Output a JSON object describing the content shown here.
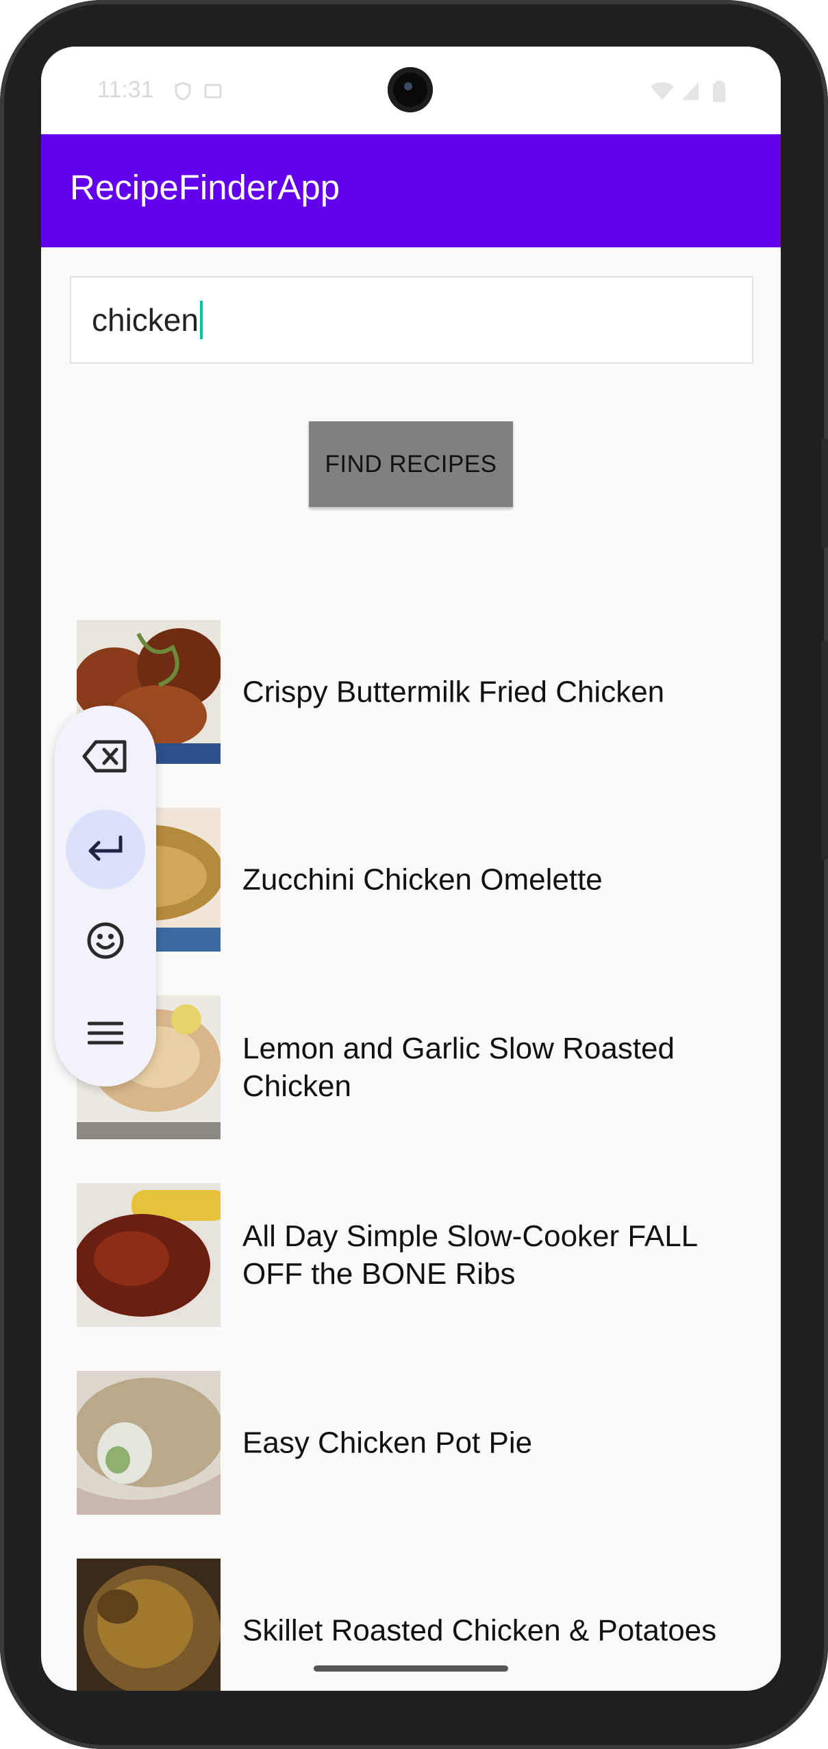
{
  "status_bar": {
    "time": "11:31"
  },
  "app_bar": {
    "title": "RecipeFinderApp",
    "color": "#6200ee"
  },
  "search": {
    "value": "chicken"
  },
  "find_button": {
    "label": "FIND RECIPES"
  },
  "recipes": [
    {
      "title": "Crispy Buttermilk Fried Chicken"
    },
    {
      "title": "Zucchini Chicken Omelette"
    },
    {
      "title": "Lemon and Garlic Slow Roasted Chicken"
    },
    {
      "title": "All Day Simple Slow-Cooker FALL OFF the BONE Ribs"
    },
    {
      "title": "Easy Chicken Pot Pie"
    },
    {
      "title": "Skillet Roasted Chicken & Potatoes"
    }
  ],
  "keyboard_toolbar": {
    "buttons": [
      {
        "icon": "backspace-icon"
      },
      {
        "icon": "enter-icon",
        "active": true
      },
      {
        "icon": "emoji-icon"
      },
      {
        "icon": "menu-icon"
      }
    ]
  }
}
